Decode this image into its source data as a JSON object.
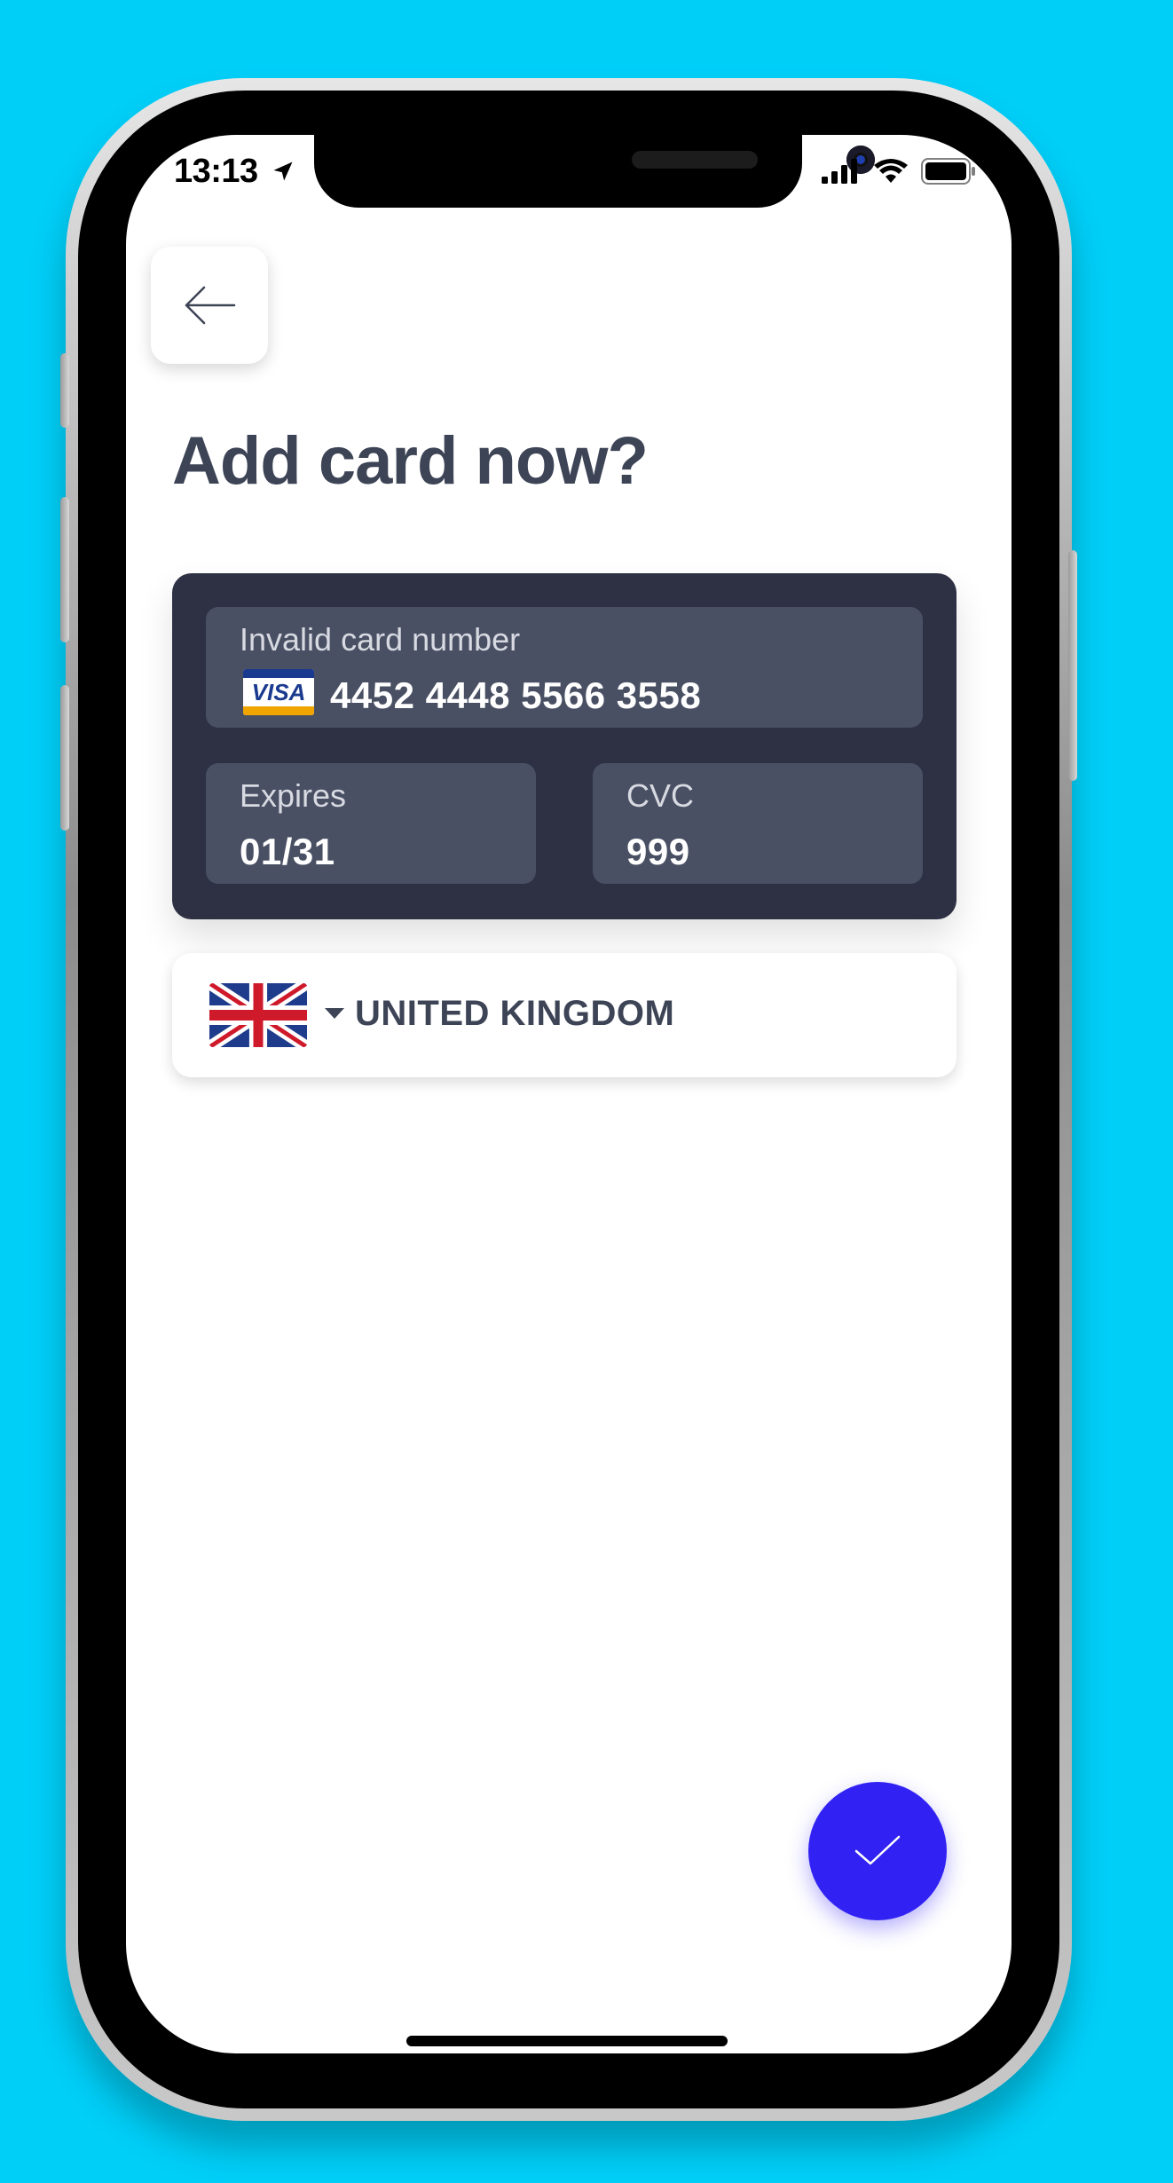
{
  "status_bar": {
    "time": "13:13",
    "location_icon": "location-arrow-icon",
    "signal_icon": "cellular-signal-icon",
    "wifi_icon": "wifi-icon",
    "battery_icon": "battery-icon"
  },
  "header": {
    "back_icon": "arrow-left-icon",
    "title": "Add card now?"
  },
  "card_form": {
    "card_number": {
      "label": "Invalid card number",
      "value": "4452 4448 5566 3558",
      "brand": "VISA",
      "brand_icon": "visa-logo-icon"
    },
    "expires": {
      "label": "Expires",
      "value": "01/31"
    },
    "cvc": {
      "label": "CVC",
      "value": "999"
    }
  },
  "country": {
    "flag_icon": "uk-flag-icon",
    "dropdown_icon": "chevron-down-icon",
    "selected": "UNITED KINGDOM"
  },
  "actions": {
    "confirm_icon": "checkmark-icon"
  },
  "colors": {
    "background": "#00cff8",
    "title_text": "#3d4456",
    "card_panel": "#2d3143",
    "field_bg": "#4a5064",
    "fab": "#3122f3"
  }
}
